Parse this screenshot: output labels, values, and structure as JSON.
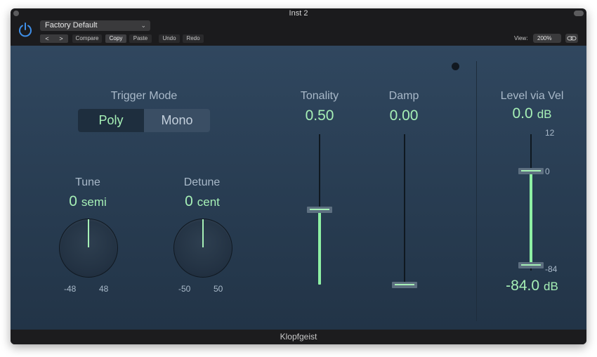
{
  "window": {
    "title": "Inst 2",
    "footer_title": "Klopfgeist"
  },
  "toolbar": {
    "preset": "Factory Default",
    "nav_prev": "<",
    "nav_next": ">",
    "compare": "Compare",
    "copy": "Copy",
    "paste": "Paste",
    "undo": "Undo",
    "redo": "Redo",
    "view_label": "View:",
    "view_value": "200%",
    "icons": {
      "power": "power-icon",
      "link": "link-icon",
      "chevron": "chevron-down-icon"
    }
  },
  "plugin": {
    "trigger_mode": {
      "label": "Trigger Mode",
      "options": [
        "Poly",
        "Mono"
      ],
      "selected": "Poly"
    },
    "tune": {
      "label": "Tune",
      "value": "0",
      "unit": "semi",
      "min": "-48",
      "max": "48",
      "level": 0.5
    },
    "detune": {
      "label": "Detune",
      "value": "0",
      "unit": "cent",
      "min": "-50",
      "max": "50",
      "level": 0.5
    },
    "tonality": {
      "label": "Tonality",
      "value": "0.50",
      "level": 0.5
    },
    "damp": {
      "label": "Damp",
      "value": "0.00",
      "level": 0.0
    },
    "level_via_vel": {
      "label": "Level via Vel",
      "upper_value": "0.0",
      "upper_unit": "dB",
      "lower_value": "-84.0",
      "lower_unit": "dB",
      "scale_top": "12",
      "scale_mid": "0",
      "scale_bottom": "-84"
    }
  },
  "colors": {
    "accent": "#a6f0b6",
    "panel": "#2a3f55"
  }
}
